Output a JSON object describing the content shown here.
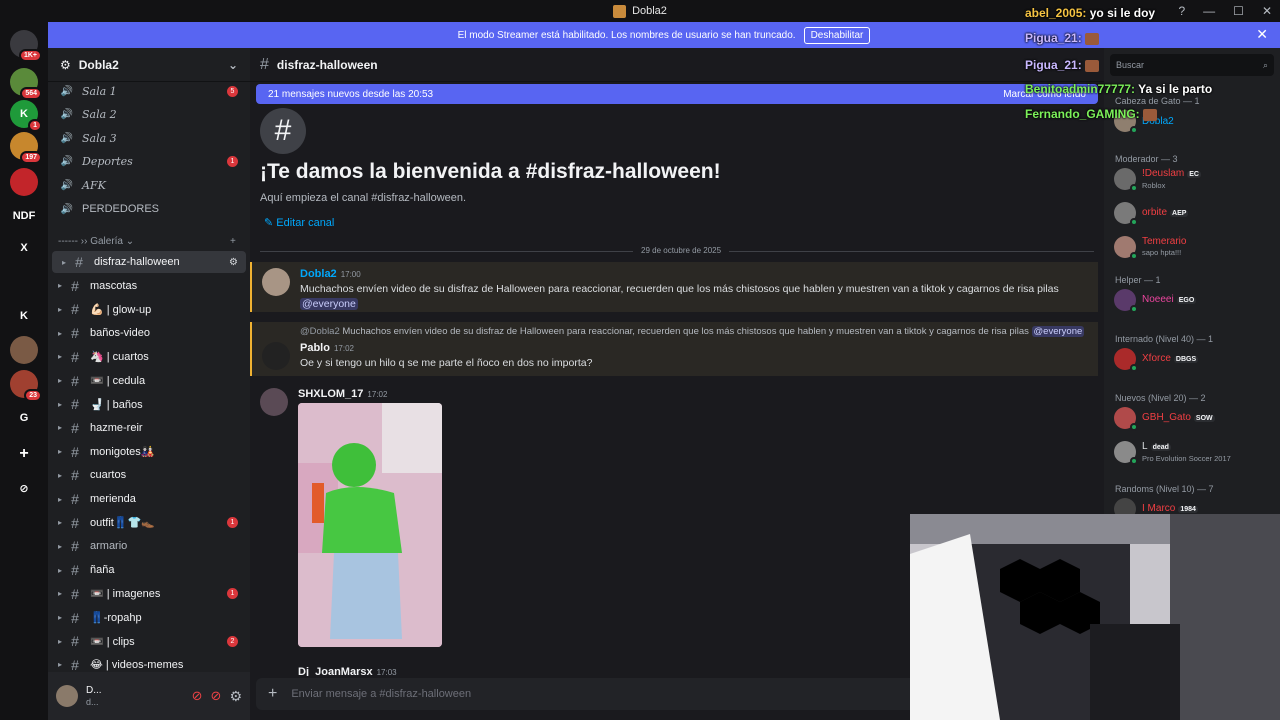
{
  "window": {
    "title": "Dobla2"
  },
  "banner": {
    "text": "El modo Streamer está habilitado. Los nombres de usuario se han truncado.",
    "button": "Deshabilitar"
  },
  "rail": {
    "servers": [
      {
        "label": "",
        "badge": "1K+",
        "color": "#3a3a3f"
      },
      {
        "label": "",
        "badge": "564",
        "color": "#5a8a3a"
      },
      {
        "label": "K",
        "badge": "1",
        "color": "#1f9a3a"
      },
      {
        "label": "",
        "badge": "197",
        "color": "#c7872d"
      },
      {
        "label": "",
        "badge": "",
        "color": "#c2252a"
      },
      {
        "label": "NDF",
        "badge": "",
        "color": "#121214"
      },
      {
        "label": "X",
        "badge": "",
        "color": "#121214"
      },
      {
        "label": "",
        "badge": "",
        "color": "#121214"
      },
      {
        "label": "K",
        "badge": "",
        "color": "#121214"
      },
      {
        "label": "",
        "badge": "",
        "color": "#7a5a45"
      },
      {
        "label": "",
        "badge": "23",
        "color": "#a04030"
      },
      {
        "label": "G",
        "badge": "",
        "color": "#121214"
      }
    ]
  },
  "sidebar": {
    "server_name": "Dobla2",
    "voice": [
      {
        "label": "Sala 1",
        "badge": "5"
      },
      {
        "label": "Sala 2",
        "badge": ""
      },
      {
        "label": "Sala 3",
        "badge": ""
      },
      {
        "label": "Deportes",
        "badge": "1"
      },
      {
        "label": "AFK",
        "badge": ""
      },
      {
        "label": "PERDEDORES",
        "badge": ""
      }
    ],
    "category": "------ ›› Galería",
    "channels": [
      {
        "label": "disfraz-halloween",
        "badge": "",
        "white": true
      },
      {
        "label": "mascotas",
        "badge": "",
        "white": true
      },
      {
        "label": "💪🏻 | glow-up",
        "badge": "",
        "white": true
      },
      {
        "label": "baños-video",
        "badge": "",
        "white": true
      },
      {
        "label": "🦄 | cuartos",
        "badge": "",
        "white": true
      },
      {
        "label": "📼 | cedula",
        "badge": "",
        "white": true
      },
      {
        "label": "🚽 | baños",
        "badge": "",
        "white": true
      },
      {
        "label": "hazme-reir",
        "badge": "",
        "white": true
      },
      {
        "label": "monigotes🎎",
        "badge": "",
        "white": true
      },
      {
        "label": "cuartos",
        "badge": "",
        "white": true
      },
      {
        "label": "merienda",
        "badge": "",
        "white": true
      },
      {
        "label": "outfit👖👕👞",
        "badge": "1",
        "white": true
      },
      {
        "label": "armario",
        "badge": "",
        "white": false
      },
      {
        "label": "ñaña",
        "badge": "",
        "white": true
      },
      {
        "label": "📼 | imagenes",
        "badge": "1",
        "white": true
      },
      {
        "label": "👖-ropahp",
        "badge": "",
        "white": true
      },
      {
        "label": "📼 | clips",
        "badge": "2",
        "white": true
      },
      {
        "label": "😂 | videos-memes",
        "badge": "",
        "white": true
      }
    ]
  },
  "user_panel": {
    "name": "D...",
    "status": "d..."
  },
  "main": {
    "channel": "disfraz-halloween",
    "new_messages": "21 mensajes nuevos desde las 20:53",
    "mark_read": "Marcar como leído",
    "welcome_title": "¡Te damos la bienvenida a #disfraz-halloween!",
    "welcome_sub": "Aquí empieza el canal #disfraz-halloween.",
    "edit_channel": "Editar canal",
    "date_divider": "29 de octubre de 2025",
    "messages": [
      {
        "author": "Dobla2",
        "time": "17:00",
        "text": "Muchachos envíen video de su disfraz de Halloween para reaccionar, recuerden que los más chistosos que hablen y muestren van a tiktok y cagarnos de risa pilas",
        "mention": "@everyone"
      },
      {
        "reply_author": "@Dobla2",
        "reply_text": "Muchachos envíen video de su disfraz de Halloween para reaccionar, recuerden que los más chistosos que hablen y muestren van a tiktok y cagarnos de risa pilas",
        "reply_mention": "@everyone",
        "author": "Pablo",
        "time": "17:02",
        "text": "Oe y si tengo un hilo q se me parte el ñoco en dos no importa?"
      },
      {
        "author": "SHXLOM_17",
        "time": "17:02",
        "text": ""
      },
      {
        "author": "Dj_JoanMarsx",
        "time": "17:03",
        "text": ""
      }
    ],
    "composer_placeholder": "Enviar mensaje a #disfraz-halloween"
  },
  "members": {
    "search_placeholder": "Buscar",
    "groups": [
      {
        "header": "Cabeza de Gato — 1",
        "items": [
          {
            "name": "Dobla2",
            "tag": "",
            "activity": "",
            "color": "#00a8fc"
          }
        ]
      },
      {
        "header": "Moderador — 3",
        "items": [
          {
            "name": "!Deuslam",
            "tag": "EC",
            "activity": "Roblox",
            "color": "#f23f43"
          },
          {
            "name": "orbite",
            "tag": "AEP",
            "activity": "",
            "color": "#f23f43"
          },
          {
            "name": "Temerario",
            "tag": "",
            "activity": "sapo hpta!!!",
            "color": "#f23f43"
          }
        ]
      },
      {
        "header": "Helper — 1",
        "items": [
          {
            "name": "Noeeei",
            "tag": "EGO",
            "activity": "",
            "color": "#eb459e"
          }
        ]
      },
      {
        "header": "Internado (Nivel 40) — 1",
        "items": [
          {
            "name": "Xforce",
            "tag": "DBGS",
            "activity": "",
            "color": "#f23f43"
          }
        ]
      },
      {
        "header": "Nuevos (Nivel 20) — 2",
        "items": [
          {
            "name": "GBH_Gato",
            "tag": "SOW",
            "activity": "",
            "color": "#f23f43"
          },
          {
            "name": "L",
            "tag": "dead",
            "activity": "Pro Evolution Soccer 2017",
            "color": "#dbdee1"
          }
        ]
      },
      {
        "header": "Randoms (Nivel 10) — 7",
        "items": [
          {
            "name": "I Marco",
            "tag": "1984",
            "activity": "",
            "color": "#f23f43"
          }
        ]
      }
    ]
  },
  "chat_overlay": [
    {
      "user": "abel_2005:",
      "msg": "yo si le doy",
      "color": "#f6c443"
    },
    {
      "user": "Pigua_21:",
      "msg": "",
      "color": "#c9b8ff"
    },
    {
      "user": "Pigua_21:",
      "msg": "",
      "color": "#c9b8ff"
    },
    {
      "user": "Benitoadmin77777:",
      "msg": "Ya si le parto",
      "color": "#7cf05a"
    },
    {
      "user": "Fernando_GAMING:",
      "msg": "",
      "color": "#7cf05a"
    }
  ]
}
